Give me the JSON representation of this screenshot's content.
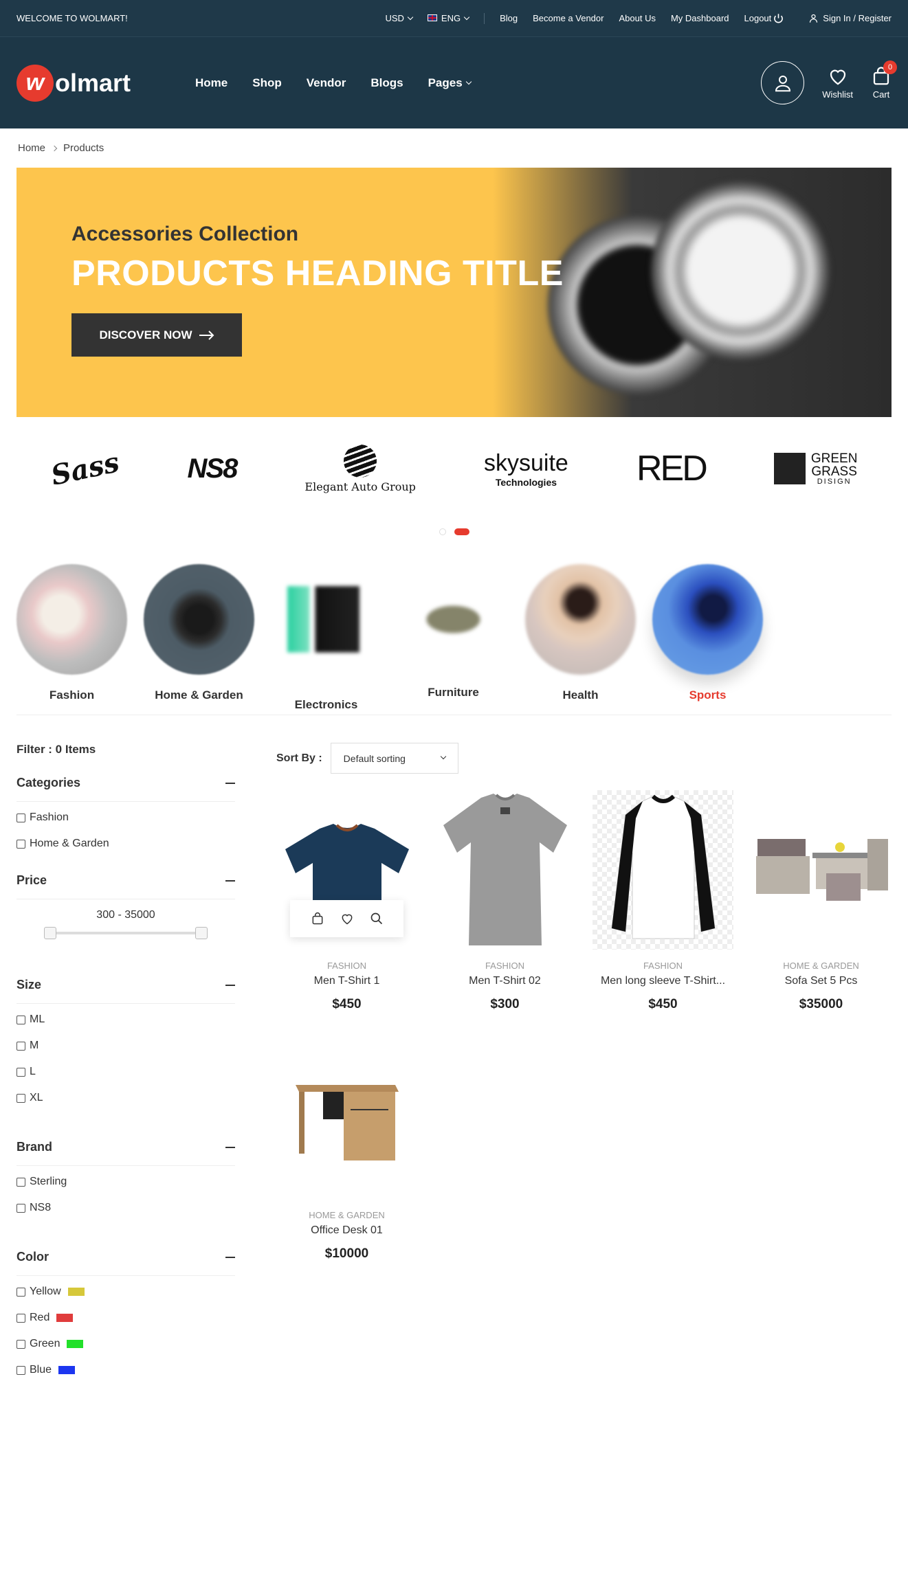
{
  "topbar": {
    "welcome": "WELCOME TO WOLMART!",
    "currency": "USD",
    "language": "ENG",
    "links": [
      "Blog",
      "Become a Vendor",
      "About Us",
      "My Dashboard",
      "Logout"
    ],
    "signin": "Sign In / Register"
  },
  "header": {
    "logo_text": "olmart",
    "logo_mark": "w",
    "nav": [
      "Home",
      "Shop",
      "Vendor",
      "Blogs",
      "Pages"
    ],
    "wishlist": "Wishlist",
    "cart": "Cart",
    "cart_count": "0"
  },
  "breadcrumb": [
    "Home",
    "Products"
  ],
  "banner": {
    "subtitle": "Accessories Collection",
    "title": "PRODUCTS HEADING TITLE",
    "button": "DISCOVER NOW"
  },
  "brands": [
    "Sass",
    "NS8",
    "Elegant Auto Group",
    "skysuite",
    "Technologies",
    "RED",
    "GREEN",
    "GRASS",
    "DISIGN"
  ],
  "categories": [
    {
      "label": "Fashion",
      "active": false
    },
    {
      "label": "Home & Garden",
      "active": false
    },
    {
      "label": "Electronics",
      "active": false
    },
    {
      "label": "Furniture",
      "active": false
    },
    {
      "label": "Health",
      "active": false
    },
    {
      "label": "Sports",
      "active": true
    }
  ],
  "filter": {
    "title": "Filter : 0 Items",
    "groups": {
      "categories": {
        "title": "Categories",
        "items": [
          "Fashion",
          "Home & Garden"
        ]
      },
      "price": {
        "title": "Price",
        "range": "300 - 35000"
      },
      "size": {
        "title": "Size",
        "items": [
          "ML",
          "M",
          "L",
          "XL"
        ]
      },
      "brand": {
        "title": "Brand",
        "items": [
          "Sterling",
          "NS8"
        ]
      },
      "color": {
        "title": "Color",
        "items": [
          {
            "label": "Yellow",
            "color": "#d6c83a"
          },
          {
            "label": "Red",
            "color": "#e03c3c"
          },
          {
            "label": "Green",
            "color": "#22e02a"
          },
          {
            "label": "Blue",
            "color": "#1c36f0"
          }
        ]
      }
    }
  },
  "sort": {
    "label": "Sort By :",
    "value": "Default sorting"
  },
  "products": [
    {
      "category": "FASHION",
      "name": "Men T-Shirt 1",
      "price": "$450"
    },
    {
      "category": "FASHION",
      "name": "Men T-Shirt 02",
      "price": "$300"
    },
    {
      "category": "FASHION",
      "name": "Men long sleeve T-Shirt...",
      "price": "$450"
    },
    {
      "category": "HOME & GARDEN",
      "name": "Sofa Set 5 Pcs",
      "price": "$35000"
    },
    {
      "category": "HOME & GARDEN",
      "name": "Office Desk 01",
      "price": "$10000"
    }
  ]
}
